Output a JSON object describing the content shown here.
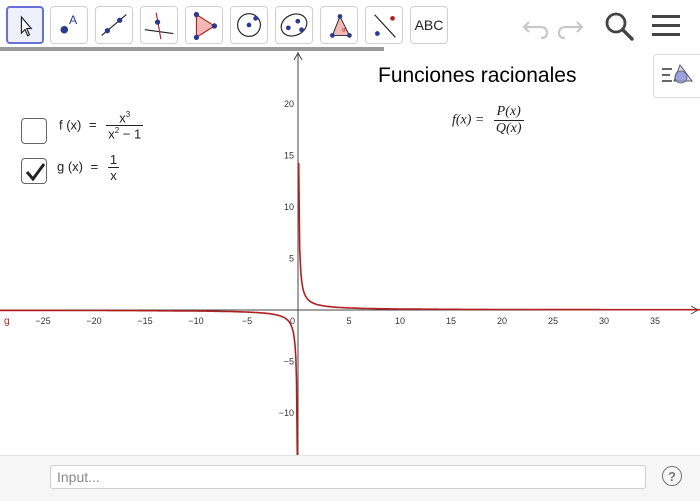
{
  "toolbar": {
    "tools": [
      {
        "name": "move-tool"
      },
      {
        "name": "point-tool"
      },
      {
        "name": "line-tool"
      },
      {
        "name": "perpendicular-line-tool"
      },
      {
        "name": "polygon-tool"
      },
      {
        "name": "circle-tool"
      },
      {
        "name": "ellipse-tool"
      },
      {
        "name": "angle-tool"
      },
      {
        "name": "reflect-tool"
      },
      {
        "name": "text-tool",
        "label": "ABC"
      }
    ],
    "icons": [
      "undo-icon",
      "redo-icon",
      "search-icon",
      "menu-icon"
    ]
  },
  "title": "Funciones racionales",
  "general_formula": {
    "lhs": "f(x) =",
    "numerator": "P(x)",
    "denominator": "Q(x)"
  },
  "functions": [
    {
      "label": "f (x)",
      "eq": "=",
      "numerator": "x3",
      "numerator_base": "x",
      "numerator_exp": "3",
      "denominator_base": "x",
      "denominator_exp": "2",
      "denominator_rest": " − 1",
      "checked": false
    },
    {
      "label": "g (x)",
      "eq": "=",
      "numerator": "1",
      "denominator": "x",
      "checked": true
    }
  ],
  "curve_label": "g",
  "curve_color": "#b02020",
  "axes": {
    "x_ticks": [
      "−25",
      "−20",
      "−15",
      "−10",
      "−5",
      "0",
      "5",
      "10",
      "15",
      "20",
      "25",
      "30",
      "35"
    ],
    "y_ticks": [
      "20",
      "15",
      "10",
      "5",
      "−5",
      "−10"
    ]
  },
  "input_bar": {
    "placeholder": "Input...",
    "help": "?"
  }
}
